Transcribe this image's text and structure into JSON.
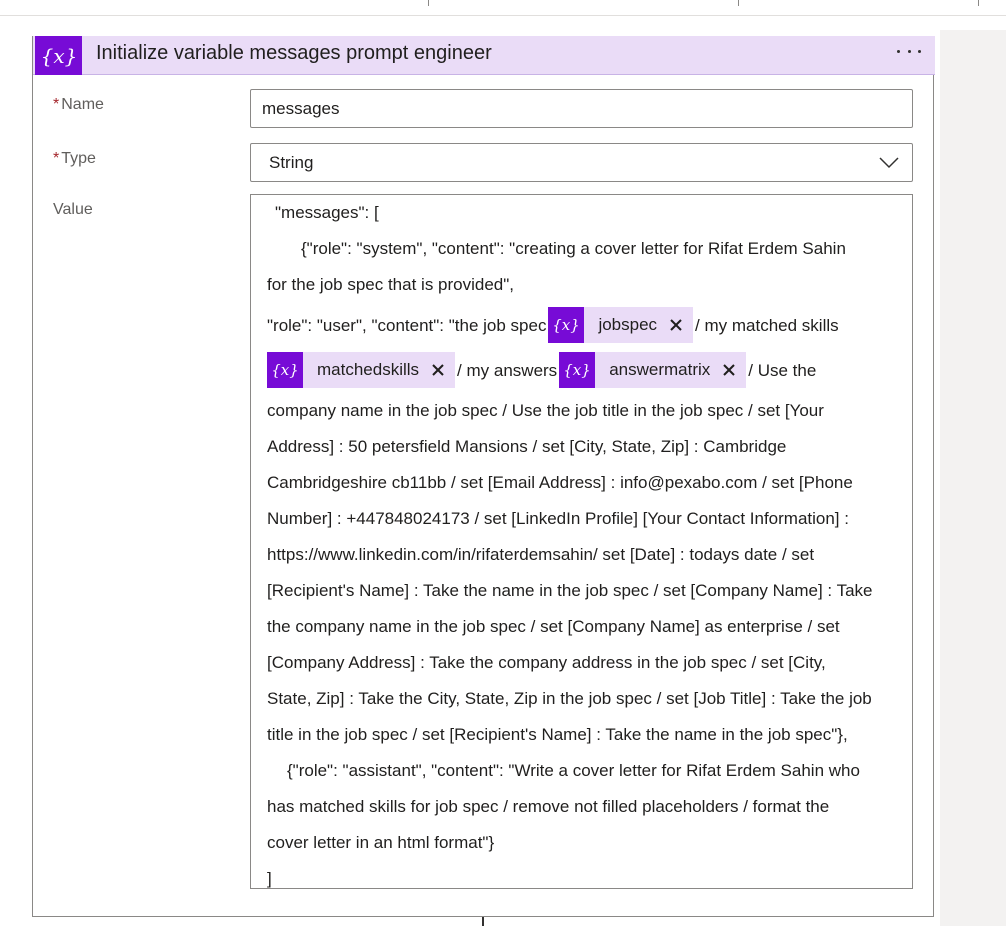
{
  "action": {
    "title": "Initialize variable messages prompt engineer",
    "header_color": "#eadcf7",
    "icon_color": "#770bd6",
    "icon": "variable-icon",
    "more_icon": "more-options-icon"
  },
  "fields": {
    "name": {
      "label": "Name",
      "required_mark": "*",
      "value": "messages"
    },
    "type": {
      "label": "Type",
      "required_mark": "*",
      "value": "String",
      "icon": "chevron-down-icon"
    },
    "value": {
      "label": "Value"
    }
  },
  "value_content": {
    "line1": "\"messages\": [",
    "line2": "{\"role\": \"system\", \"content\": \"creating a cover letter for Rifat Erdem Sahin",
    "line3": "for the job spec that is provided\",",
    "line4_a": "\"role\": \"user\", \"content\": \"the job spec",
    "token_jobspec": "jobspec",
    "line4_b": "/ my matched skills",
    "token_matchedskills": "matchedskills",
    "line5_a": "/ my answers",
    "token_answermatrix": "answermatrix",
    "line5_b": "/ Use the",
    "line6": "company name in the job spec / Use the job title in the job spec / set [Your",
    "line7": "Address] : 50 petersfield Mansions / set [City, State, Zip] : Cambridge",
    "line8": "Cambridgeshire cb11bb / set [Email Address] : info@pexabo.com / set [Phone",
    "line9": "Number] : +447848024173 / set [LinkedIn Profile]  [Your Contact Information] :",
    "line10": "https://www.linkedin.com/in/rifaterdemsahin/ set [Date] : todays date / set",
    "line11": "[Recipient's Name] : Take the name in the job spec / set [Company Name] : Take",
    "line12": "the company name in the job spec / set [Company Name] as enterprise / set",
    "line13": "[Company Address] : Take the company address in the job spec / set [City,",
    "line14": "State, Zip] : Take the City, State, Zip in the job spec / set [Job Title] : Take the job",
    "line15": "title in the job spec / set [Recipient's Name] : Take the name in the job spec\"},",
    "line16": "{\"role\": \"assistant\", \"content\": \"Write a cover letter for Rifat Erdem Sahin who",
    "line17": "has matched skills for job spec / remove not filled placeholders / format the",
    "line18": "cover letter in an html format\"}",
    "line19": "]"
  }
}
